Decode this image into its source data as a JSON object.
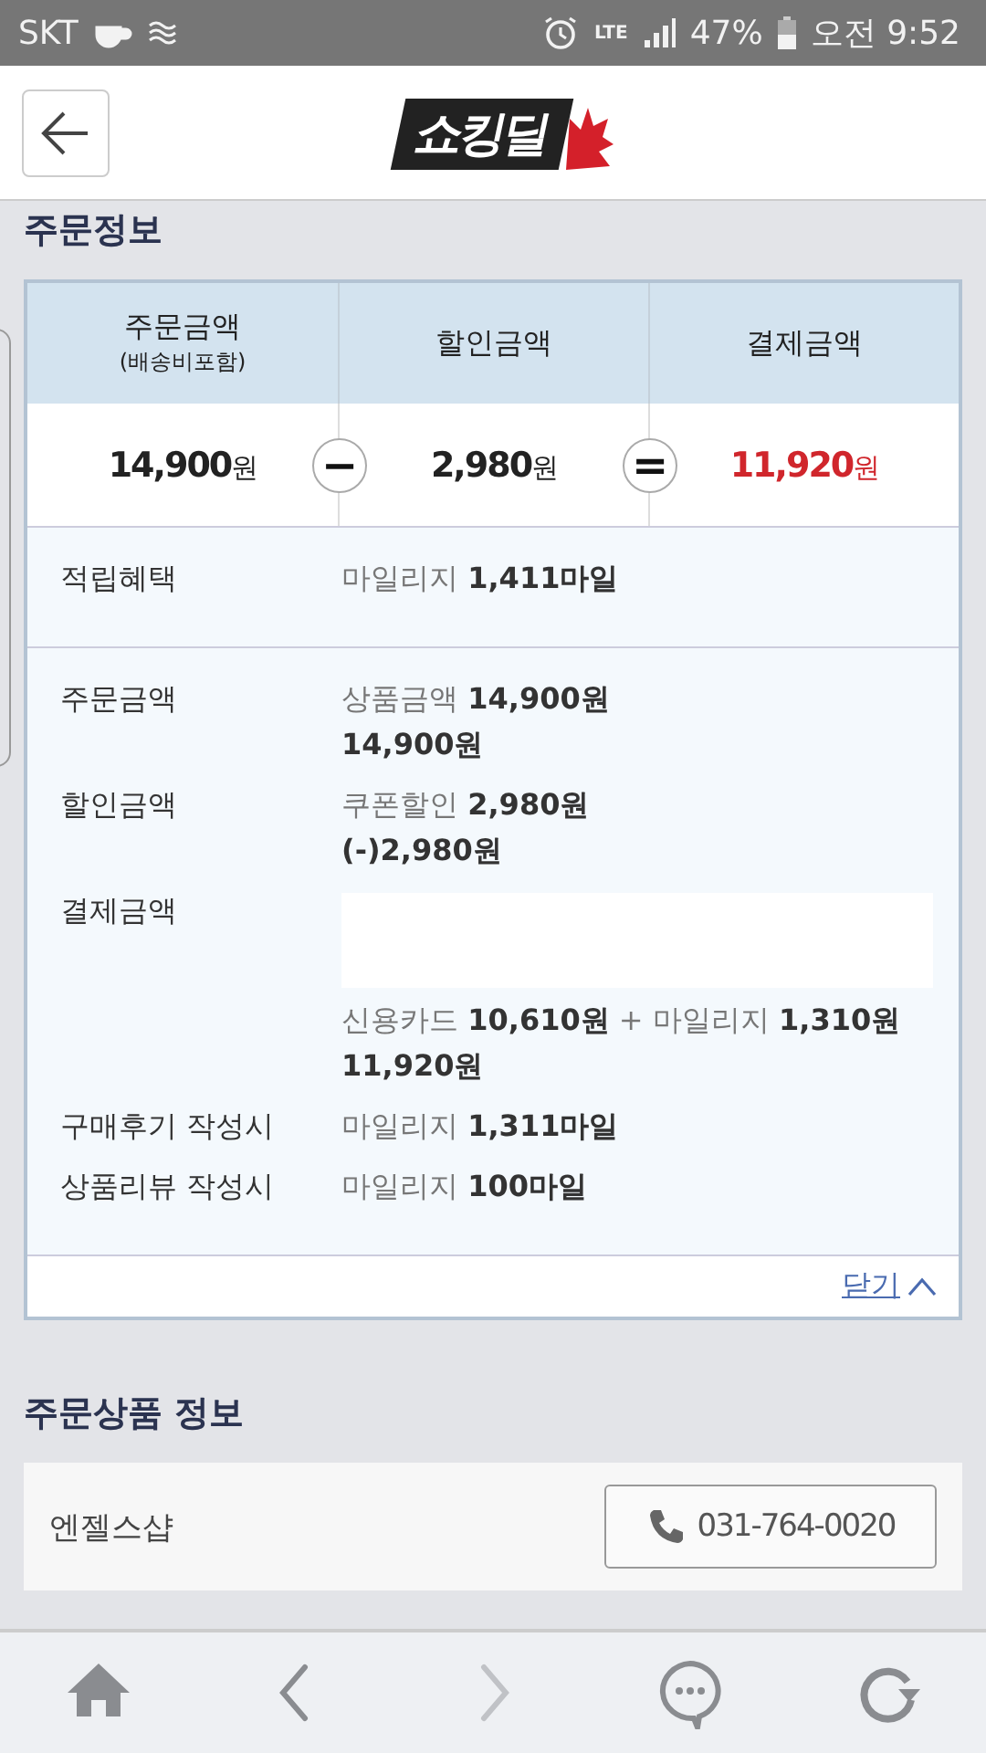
{
  "status_bar": {
    "carrier": "SKT",
    "network": "LTE",
    "battery": "47%",
    "time": "오전 9:52"
  },
  "header": {
    "logo": "쇼킹딜"
  },
  "order_info": {
    "title": "주문정보",
    "summary": [
      {
        "label": "주문금액",
        "sublabel": "(배송비포함)",
        "amount": "14,900",
        "unit": "원",
        "highlight": false,
        "operator": "−"
      },
      {
        "label": "할인금액",
        "amount": "2,980",
        "unit": "원",
        "highlight": false,
        "operator": "="
      },
      {
        "label": "결제금액",
        "amount": "11,920",
        "unit": "원",
        "highlight": true
      }
    ],
    "benefit": {
      "label": "적립혜택",
      "value": "마일리지 **1,411마일**"
    },
    "details": [
      {
        "label": "주문금액",
        "lines": [
          {
            "kind": "text",
            "text": "상품금액 **14,900원**"
          },
          {
            "kind": "bold",
            "text": "14,900원"
          }
        ]
      },
      {
        "label": "할인금액",
        "lines": [
          {
            "kind": "text",
            "text": "쿠폰할인 **2,980원**"
          },
          {
            "kind": "bold",
            "text": "(-)2,980원"
          }
        ]
      },
      {
        "label": "결제금액",
        "lines": [
          {
            "kind": "blank"
          },
          {
            "kind": "text",
            "text": "신용카드 **10,610원** + 마일리지 **1,310원**"
          },
          {
            "kind": "bold",
            "text": "11,920원"
          }
        ]
      },
      {
        "label": "구매후기 작성시",
        "lines": [
          {
            "kind": "text",
            "text": "마일리지 **1,311마일**"
          }
        ]
      },
      {
        "label": "상품리뷰 작성시",
        "lines": [
          {
            "kind": "text",
            "text": "마일리지 **100마일**"
          }
        ]
      }
    ],
    "close_link": "닫기"
  },
  "product_info": {
    "title": "주문상품 정보",
    "seller": "엔젤스샵",
    "phone": "031-764-0020"
  },
  "bottom_nav": [
    {
      "kind": "home",
      "disabled": false
    },
    {
      "kind": "back",
      "disabled": false
    },
    {
      "kind": "forward",
      "disabled": true
    },
    {
      "kind": "chat",
      "disabled": false
    },
    {
      "kind": "refresh",
      "disabled": false
    }
  ]
}
